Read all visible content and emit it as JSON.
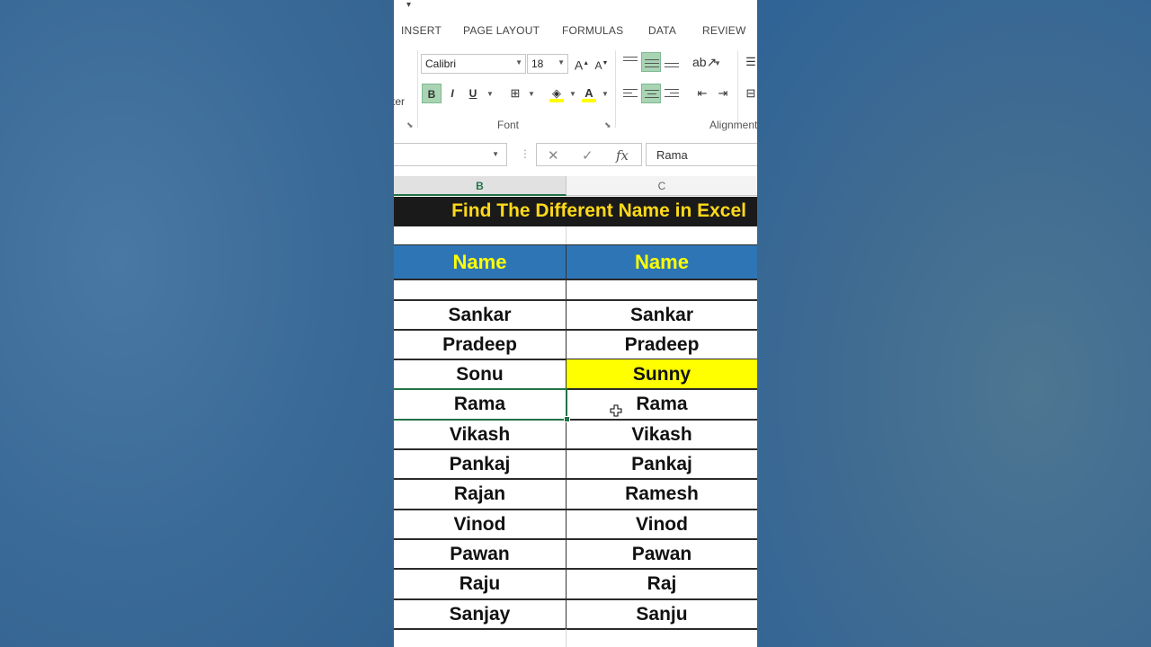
{
  "ribbon": {
    "tabs": [
      "INSERT",
      "PAGE LAYOUT",
      "FORMULAS",
      "DATA",
      "REVIEW"
    ],
    "font_name": "Calibri",
    "font_size": "18",
    "font_group_label": "Font",
    "alignment_group_label": "Alignment",
    "clipped_label": "ter",
    "grow_font": "A",
    "shrink_font": "A",
    "bold": "B",
    "italic": "I",
    "underline": "U",
    "font_color_letter": "A",
    "accent_color": "#217346"
  },
  "formula_bar": {
    "cancel": "✕",
    "enter": "✓",
    "fx": "fx",
    "value": "Rama"
  },
  "columns": {
    "b": "B",
    "c": "C"
  },
  "sheet": {
    "title": "Find The Different Name in Excel",
    "header_b": "Name",
    "header_c": "Name",
    "rows": [
      {
        "b": "Sankar",
        "c": "Sankar",
        "highlight": false
      },
      {
        "b": "Pradeep",
        "c": "Pradeep",
        "highlight": false
      },
      {
        "b": "Sonu",
        "c": "Sunny",
        "highlight": true
      },
      {
        "b": "Rama",
        "c": "Rama",
        "highlight": false
      },
      {
        "b": "Vikash",
        "c": "Vikash",
        "highlight": false
      },
      {
        "b": "Pankaj",
        "c": "Pankaj",
        "highlight": false
      },
      {
        "b": "Rajan",
        "c": "Ramesh",
        "highlight": false
      },
      {
        "b": "Vinod",
        "c": "Vinod",
        "highlight": false
      },
      {
        "b": "Pawan",
        "c": "Pawan",
        "highlight": false
      },
      {
        "b": "Raju",
        "c": "Raj",
        "highlight": false
      },
      {
        "b": "Sanjay",
        "c": "Sanju",
        "highlight": false
      }
    ],
    "highlight_color": "#ffff00",
    "header_color": "#2e75b6",
    "header_text_color": "#ffff00",
    "title_text_color": "#ffd91a"
  }
}
